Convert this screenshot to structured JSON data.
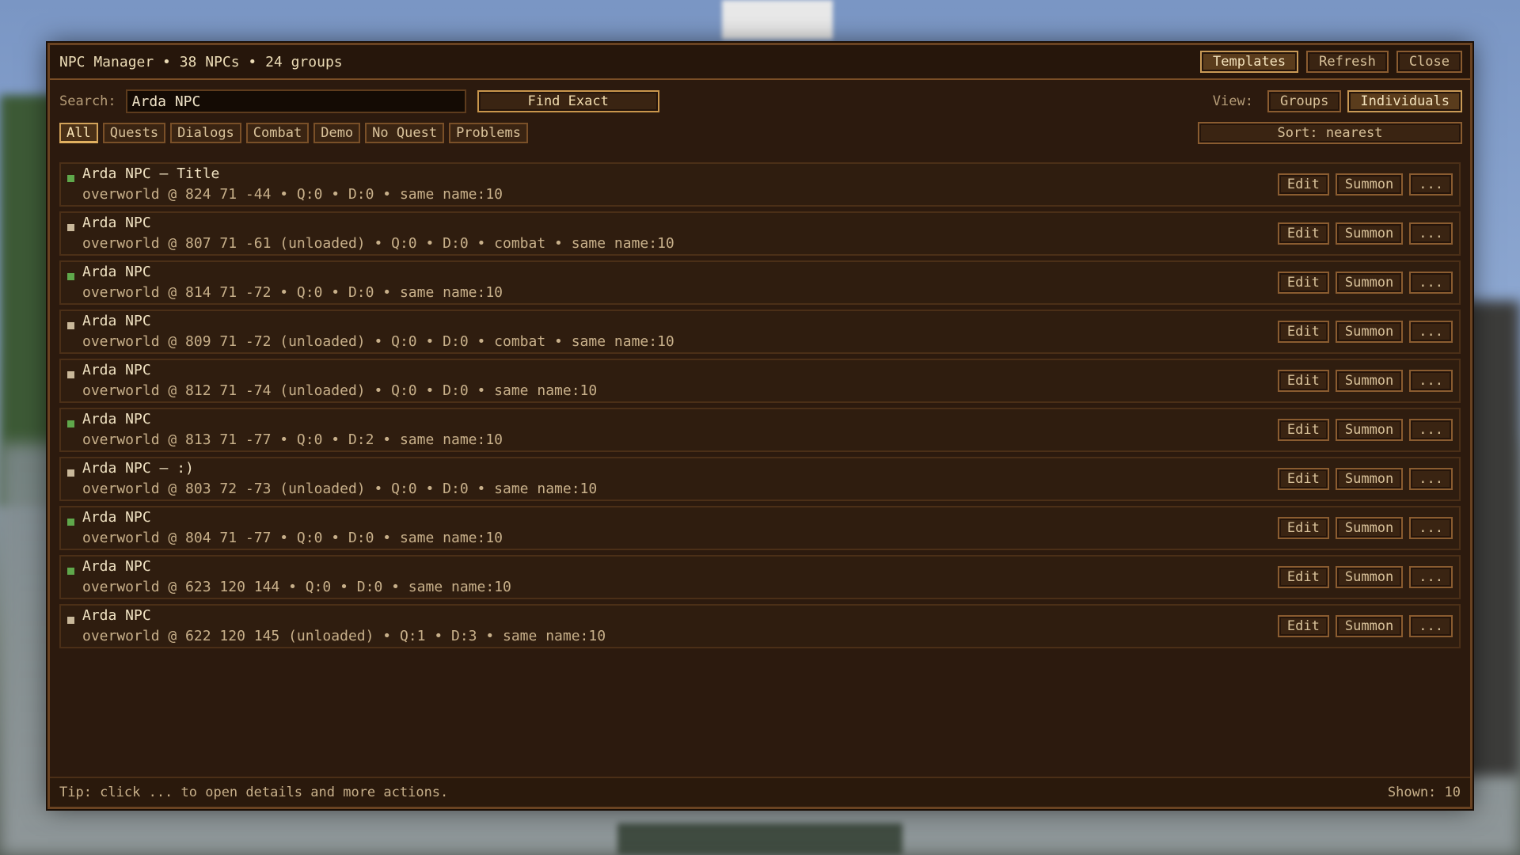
{
  "header": {
    "title": "NPC Manager • 38 NPCs • 24 groups",
    "templates_label": "Templates",
    "refresh_label": "Refresh",
    "close_label": "Close"
  },
  "search": {
    "label": "Search:",
    "value": "Arda NPC",
    "find_exact_label": "Find Exact"
  },
  "view": {
    "label": "View:",
    "groups_label": "Groups",
    "individuals_label": "Individuals",
    "selected": "Individuals"
  },
  "filters": {
    "tabs": [
      "All",
      "Quests",
      "Dialogs",
      "Combat",
      "Demo",
      "No Quest",
      "Problems"
    ],
    "active": "All"
  },
  "sort": {
    "label": "Sort: nearest"
  },
  "row_actions": {
    "edit": "Edit",
    "summon": "Summon",
    "more": "..."
  },
  "colors": {
    "loaded": "#5fa84b",
    "unloaded": "#c9b89a"
  },
  "npcs": [
    {
      "name": "Arda NPC — Title",
      "meta": "overworld @ 824 71 -44 • Q:0 • D:0 • same name:10",
      "status": "loaded"
    },
    {
      "name": "Arda NPC",
      "meta": "overworld @ 807 71 -61 (unloaded) • Q:0 • D:0 • combat • same name:10",
      "status": "unloaded"
    },
    {
      "name": "Arda NPC",
      "meta": "overworld @ 814 71 -72 • Q:0 • D:0 • same name:10",
      "status": "loaded"
    },
    {
      "name": "Arda NPC",
      "meta": "overworld @ 809 71 -72 (unloaded) • Q:0 • D:0 • combat • same name:10",
      "status": "unloaded"
    },
    {
      "name": "Arda NPC",
      "meta": "overworld @ 812 71 -74 (unloaded) • Q:0 • D:0 • same name:10",
      "status": "unloaded"
    },
    {
      "name": "Arda NPC",
      "meta": "overworld @ 813 71 -77 • Q:0 • D:2 • same name:10",
      "status": "loaded"
    },
    {
      "name": "Arda NPC — :)",
      "meta": "overworld @ 803 72 -73 (unloaded) • Q:0 • D:0 • same name:10",
      "status": "unloaded"
    },
    {
      "name": "Arda NPC",
      "meta": "overworld @ 804 71 -77 • Q:0 • D:0 • same name:10",
      "status": "loaded"
    },
    {
      "name": "Arda NPC",
      "meta": "overworld @ 623 120 144 • Q:0 • D:0 • same name:10",
      "status": "loaded"
    },
    {
      "name": "Arda NPC",
      "meta": "overworld @ 622 120 145 (unloaded) • Q:1 • D:3 • same name:10",
      "status": "unloaded"
    }
  ],
  "footer": {
    "tip": "Tip: click ... to open details and more actions.",
    "shown": "Shown: 10"
  }
}
